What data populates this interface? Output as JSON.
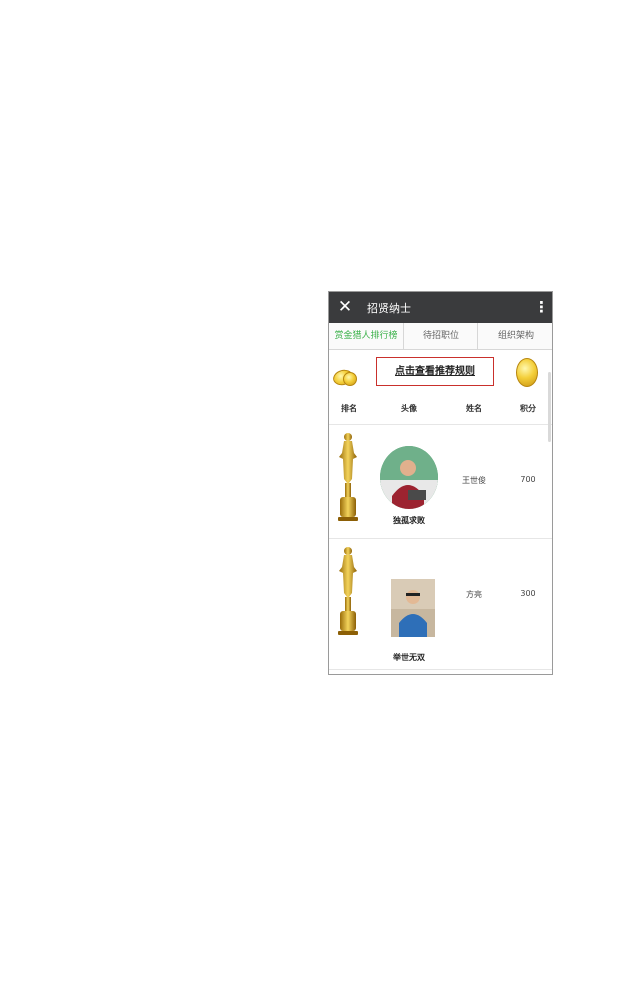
{
  "app": {
    "title": "招贤纳士",
    "close_icon": "close-icon",
    "more_icon": "more-vertical-icon"
  },
  "tabs": [
    {
      "label": "赏金猎人排行榜",
      "active": true
    },
    {
      "label": "待招职位",
      "active": false
    },
    {
      "label": "组织架构",
      "active": false
    }
  ],
  "banner": {
    "rules_link": "点击查看推荐规则"
  },
  "table": {
    "headers": [
      "排名",
      "头像",
      "姓名",
      "积分"
    ],
    "rows": [
      {
        "rank_icon": "trophy-icon",
        "nickname": "独孤求败",
        "name": "王世俊",
        "score": "700"
      },
      {
        "rank_icon": "trophy-icon",
        "nickname": "举世无双",
        "name": "方亮",
        "score": "300"
      }
    ]
  },
  "colors": {
    "titlebar": "#3a3b3d",
    "active_tab": "#3bb14a",
    "rules_border": "#c9302c",
    "gold": "#f4cf3a"
  }
}
